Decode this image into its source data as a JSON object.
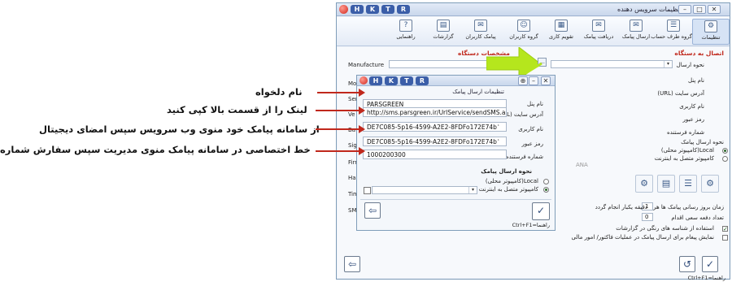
{
  "main_window": {
    "title": "تنظیمات سرویس دهنده",
    "ribbon": [
      {
        "label": "تنظیمات",
        "icon": "gear-icon",
        "glyph": "⚙"
      },
      {
        "label": "گروه طرف حساب",
        "icon": "group-icon",
        "glyph": "☰"
      },
      {
        "label": "ارسال پیامک",
        "icon": "send-sms-icon",
        "glyph": "✉"
      },
      {
        "label": "دریافت پیامک",
        "icon": "receive-sms-icon",
        "glyph": "✉"
      },
      {
        "label": "تقویم کاری",
        "icon": "calendar-icon",
        "glyph": "▦"
      },
      {
        "label": "گروه کاربران",
        "icon": "user-group-icon",
        "glyph": "☺"
      },
      {
        "label": "پیامک کاربران",
        "icon": "user-sms-icon",
        "glyph": "✉"
      },
      {
        "label": "گزارشات",
        "icon": "reports-icon",
        "glyph": "▤"
      },
      {
        "label": "راهنمایی",
        "icon": "help-icon",
        "glyph": "?"
      }
    ],
    "section_connect": "اتصال به دستگاه",
    "section_device": "مشخصات دستگاه",
    "send_method_label": "نحوه ارسال",
    "fields_right": [
      "نام پنل",
      "آدرس سایت (URL)",
      "نام کاربری",
      "رمز عبور",
      "شماره فرستنده"
    ],
    "send_type_label": "نحوه ارسال پیامک",
    "option_local": "Local(کامپیوتر محلی)",
    "option_internet": "کامپیوتر متصل به اینترنت",
    "partial_text": "ANA",
    "left_labels": [
      "Manufacture",
      "Mo",
      "Ser",
      "Ve",
      "Ba",
      "Sig",
      "Firm",
      "Har",
      "Tim",
      "SMS"
    ],
    "schedule_text": "دقیقه یکبار انجام گردد",
    "schedule_prefix": "زمان بروز رسانی پیامک ها هر",
    "schedule_value": "1",
    "retry_text": "تعداد دفعه سعی اقدام",
    "retry_value": "0",
    "check1": "استفاده از شناسه های رنگی در گزارشات",
    "check2": "نمایش پیغام برای ارسال پیامک در عملیات فاکتور/ امور مالی",
    "footer_hint": "راهنما=Ctrl+F1"
  },
  "dialog": {
    "title": "تنظیمات ارسال پیامک",
    "fields": [
      {
        "label": "نام پنل",
        "value": "PARSGREEN"
      },
      {
        "label": "آدرس سایت (URL)",
        "value": "http://sms.parsgreen.ir/UrlService/sendSMS.ashx"
      },
      {
        "label": "نام کاربری",
        "value": "DE7C085-5p16-4599-A2E2-8FDFo172E74bٔ"
      },
      {
        "label": "رمز عبور",
        "value": "DE7C085-5p16-4599-A2E2-8FDFo172E74bٔ"
      },
      {
        "label": "شماره فرستنده",
        "value": "1000200300"
      }
    ],
    "send_type_label": "نحوه ارسال پیامک",
    "option_local": "Local(کامپیوتر محلی)",
    "option_internet": "کامپیوتر متصل به اینترنت",
    "footer_hint": "راهنما=Ctrl+F1"
  },
  "title_buttons": [
    "H",
    "K",
    "T",
    "R"
  ],
  "annotations": [
    "نام دلخواه",
    "لینک را از قسمت بالا کپی کنید",
    "از سامانه پیامک خود منوی وب سرویس سپس امضای دیجیتال",
    "خط اختصاصی در سامانه پیامک منوی مدیریت سپس سفارش شماره"
  ],
  "colors": {
    "accent": "#c0281c",
    "arrow_highlight": "#b5e61d",
    "title_button": "#3b5ea8"
  }
}
